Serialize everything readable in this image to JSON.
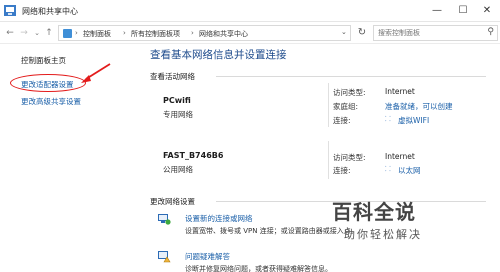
{
  "window": {
    "title": "网络和共享中心",
    "minimize_glyph": "—",
    "maximize_glyph": "☐",
    "close_glyph": "✕"
  },
  "toolbar": {
    "back_glyph": "←",
    "forward_glyph": "→",
    "history_glyph": "⌄",
    "up_glyph": "↑",
    "refresh_glyph": "↻",
    "breadcrumbs": [
      "控制面板",
      "所有控制面板项",
      "网络和共享中心"
    ],
    "separator": "›",
    "dropdown_glyph": "⌄",
    "search_placeholder": "搜索控制面板",
    "search_icon": "search-icon",
    "search_glyph": "⚲"
  },
  "sidebar": {
    "home": "控制面板主页",
    "items": [
      "更改适配器设置",
      "更改高级共享设置"
    ],
    "annotation_color": "#e31c1c"
  },
  "main": {
    "title": "查看基本网络信息并设置连接",
    "active_section": "查看活动网络",
    "networks": [
      {
        "name": "PCwifi",
        "type": "专用网络",
        "access_label": "访问类型:",
        "access_value": "Internet",
        "homegroup_label": "家庭组:",
        "homegroup_value": "准备就绪，可以创建",
        "conn_label": "连接:",
        "conn_icon": "wifi-icon",
        "conn_glyph": "⸬",
        "conn_value": "虚拟WIFI"
      },
      {
        "name": "FAST_B746B6",
        "type": "公用网络",
        "access_label": "访问类型:",
        "access_value": "Internet",
        "conn_label": "连接:",
        "conn_icon": "ethernet-icon",
        "conn_glyph": "⸬",
        "conn_value": "以太网"
      }
    ],
    "change_section": "更改网络设置",
    "tasks": [
      {
        "link": "设置新的连接或网络",
        "desc": "设置宽带、拨号或 VPN 连接；或设置路由器或接入点。",
        "icon": "new-connection-icon"
      },
      {
        "link": "问题疑难解答",
        "desc": "诊断并修复网络问题，或者获得疑难解答信息。",
        "icon": "troubleshoot-icon"
      }
    ]
  },
  "watermark": {
    "logo": "百科全说",
    "subtitle": "助你轻松解决"
  },
  "colors": {
    "link": "#1a5fa8",
    "title": "#1e4b8c",
    "annotation": "#e31c1c"
  }
}
